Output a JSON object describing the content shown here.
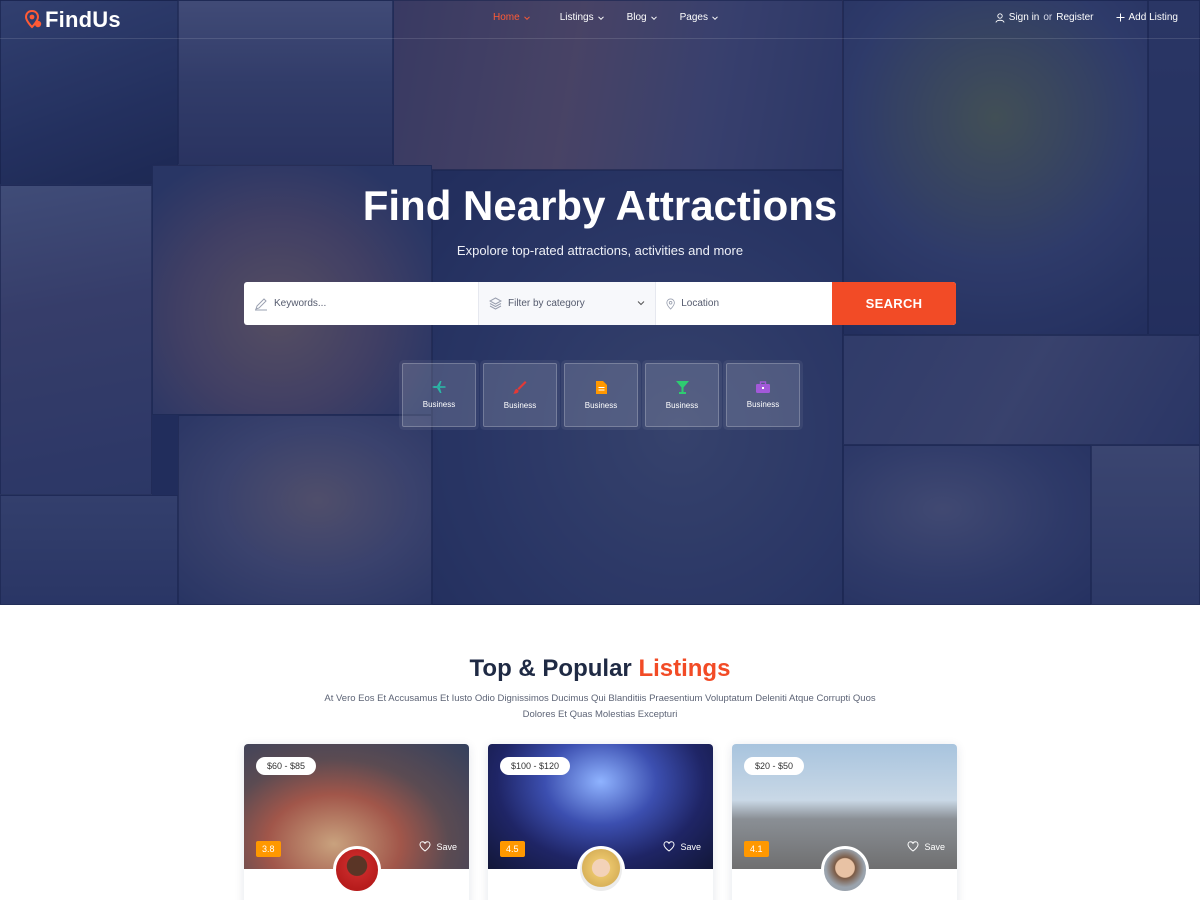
{
  "brand": {
    "name": "FindUs",
    "accent": "#f24b26"
  },
  "nav": {
    "items": [
      {
        "label": "Home",
        "active": true
      },
      {
        "label": "Listings",
        "active": false
      },
      {
        "label": "Blog",
        "active": false
      },
      {
        "label": "Pages",
        "active": false
      }
    ],
    "signin": "Sign in",
    "or": "or",
    "register": "Register",
    "add_listing": "Add Listing"
  },
  "hero": {
    "title": "Find Nearby Attractions",
    "subtitle": "Expolore top-rated attractions, activities and more"
  },
  "search": {
    "keywords_placeholder": "Keywords...",
    "category_label": "Filter by category",
    "location_placeholder": "Location",
    "button": "SEARCH"
  },
  "categories": [
    {
      "label": "Business",
      "icon": "plane-icon",
      "color": "#2bb7a6"
    },
    {
      "label": "Business",
      "icon": "brush-icon",
      "color": "#e53935"
    },
    {
      "label": "Business",
      "icon": "document-icon",
      "color": "#ff9800"
    },
    {
      "label": "Business",
      "icon": "cocktail-icon",
      "color": "#2ecc71"
    },
    {
      "label": "Business",
      "icon": "briefcase-icon",
      "color": "#a259d9"
    }
  ],
  "section": {
    "title_main": "Top & Popular",
    "title_accent": "Listings",
    "description": "At Vero Eos Et Accusamus Et Iusto Odio Dignissimos Ducimus Qui Blanditiis Praesentium Voluptatum Deleniti Atque Corrupti Quos Dolores Et Quas Molestias Excepturi"
  },
  "listings": [
    {
      "price": "$60 - $85",
      "rating": "3.8",
      "save": "Save"
    },
    {
      "price": "$100 - $120",
      "rating": "4.5",
      "save": "Save"
    },
    {
      "price": "$20 - $50",
      "rating": "4.1",
      "save": "Save"
    }
  ]
}
